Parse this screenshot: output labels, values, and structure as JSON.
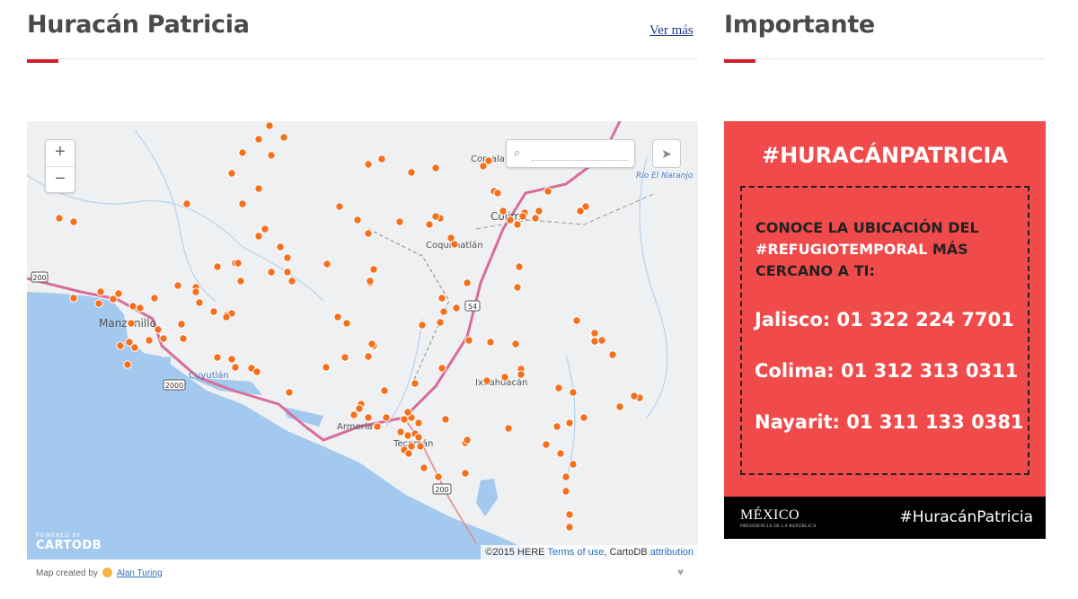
{
  "left": {
    "title": "Huracán Patricia",
    "more_link": "Ver más"
  },
  "right": {
    "title": "Importante"
  },
  "map": {
    "zoom_in": "+",
    "zoom_out": "−",
    "search_placeholder": "",
    "powered_by": "POWERED BY",
    "brand": "CARTODB",
    "attribution_prefix": "©2015 HERE",
    "terms_link": "Terms of use",
    "attribution_mid": ", CartoDB",
    "attribution_link": "attribution",
    "place_labels": [
      "Manzanillo",
      "Cuyutlán",
      "Armería",
      "Tecomán",
      "Coquimatlán",
      "Colima",
      "Comala",
      "Ixtlahuacán",
      "Río El Naranjo"
    ],
    "highway_shields": [
      "200",
      "200",
      "2000",
      "54"
    ],
    "marker_color": "#f4701c",
    "credit_prefix": "Map created by",
    "credit_user": "Alan Turing"
  },
  "panel": {
    "hashtag": "#HURACÁNPATRICIA",
    "intro_line1": "CONOCE LA UBICACIÓN DEL",
    "intro_highlight": "#REFUGIOTEMPORAL",
    "intro_line2": " MÁS",
    "intro_line3": "CERCANO A TI:",
    "phones": [
      "Jalisco: 01 322 224 7701",
      "Colima: 01 312 313 0311",
      "Nayarit: 01 311 133 0381"
    ],
    "footer_logo": "MÉXICO",
    "footer_sub": "PRESIDENCIA DE LA REPÚBLICA",
    "footer_hashtag": "#HuracánPatricia",
    "bg_color": "#f04a4a"
  }
}
